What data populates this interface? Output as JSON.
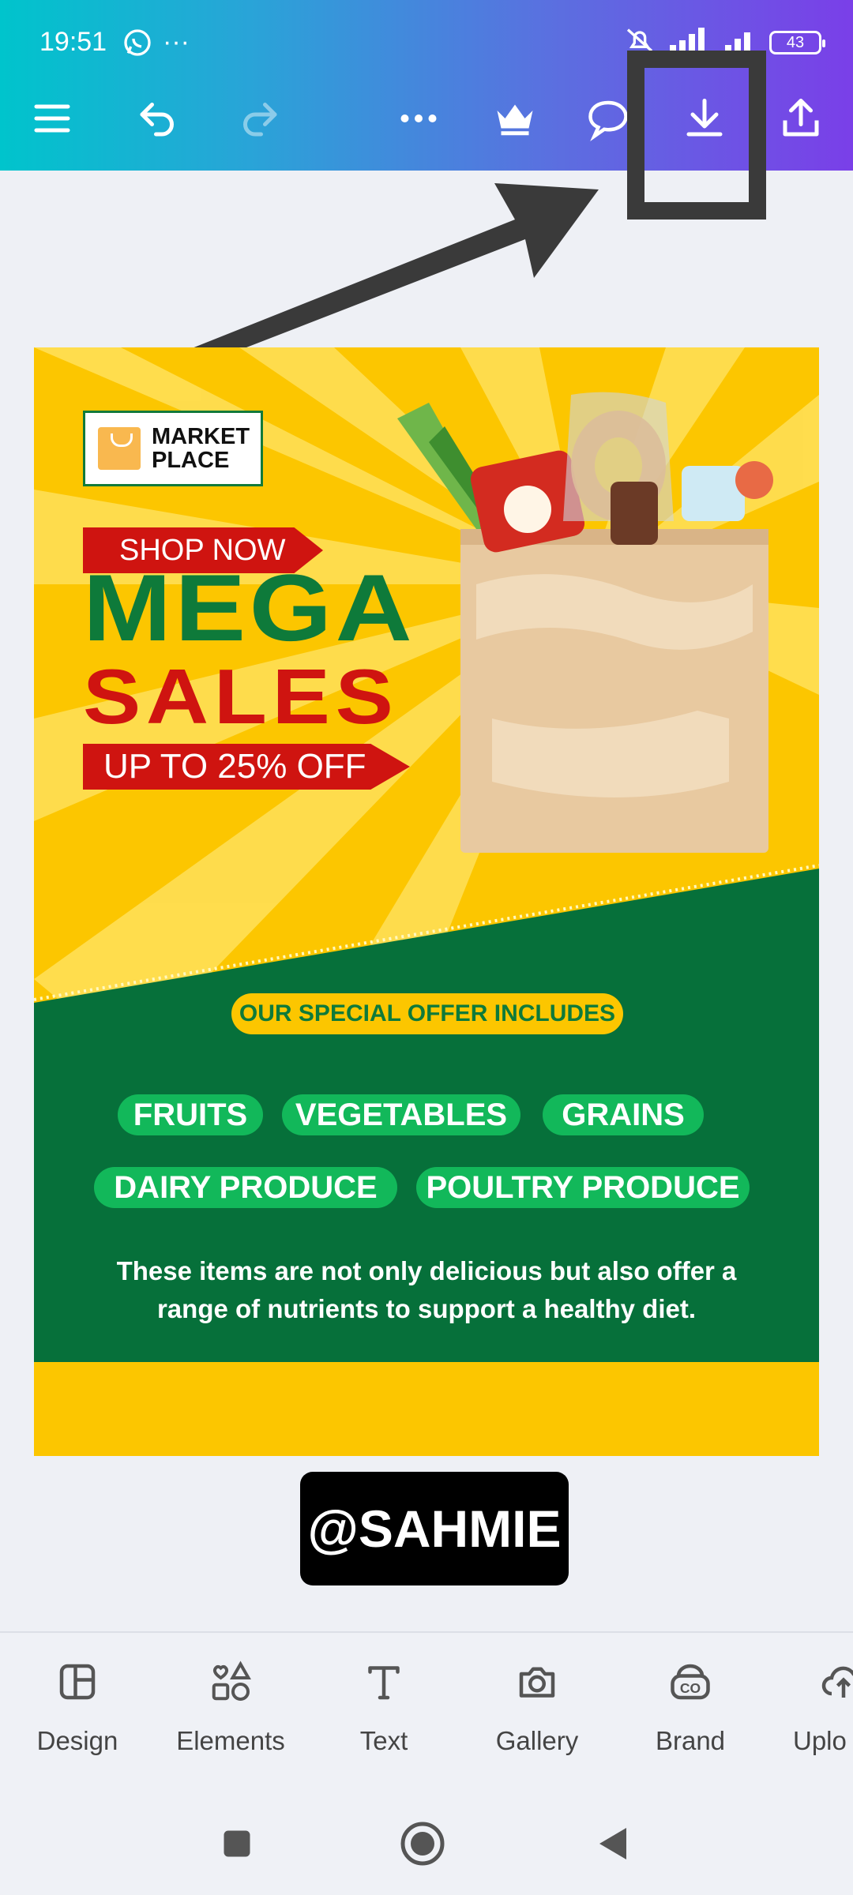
{
  "status_bar": {
    "time": "19:51",
    "battery": "43"
  },
  "colors": {
    "header_start": "#00c4cc",
    "header_end": "#7a3fe8",
    "poster_yellow": "#fcc600",
    "poster_green": "#06703a",
    "chip_green": "#12b85a",
    "brand_red": "#cf1410"
  },
  "toolbar": {
    "items": [
      {
        "icon": "menu-icon"
      },
      {
        "icon": "undo-icon"
      },
      {
        "icon": "redo-icon"
      },
      {
        "icon": "more-icon"
      },
      {
        "icon": "crown-icon"
      },
      {
        "icon": "comment-icon"
      },
      {
        "icon": "download-icon"
      },
      {
        "icon": "share-icon"
      }
    ]
  },
  "poster": {
    "logo": {
      "line1": "MARKET",
      "line2": "PLACE"
    },
    "shop_now": "SHOP NOW",
    "mega": "MEGA",
    "sales": "SALES",
    "discount": "UP TO 25% OFF",
    "offer_header": "OUR SPECIAL OFFER INCLUDES",
    "chips": [
      "FRUITS",
      "VEGETABLES",
      "GRAINS",
      "DAIRY PRODUCE",
      "POULTRY PRODUCE"
    ],
    "description": "These items are not only delicious but also offer a range of nutrients to support a healthy diet."
  },
  "watermark": "@SAHMIE",
  "bottom_tools": [
    {
      "label": "Design",
      "icon": "design-icon"
    },
    {
      "label": "Elements",
      "icon": "elements-icon"
    },
    {
      "label": "Text",
      "icon": "text-icon"
    },
    {
      "label": "Gallery",
      "icon": "camera-icon"
    },
    {
      "label": "Brand",
      "icon": "brand-icon"
    },
    {
      "label": "Uplo",
      "icon": "upload-icon"
    }
  ]
}
